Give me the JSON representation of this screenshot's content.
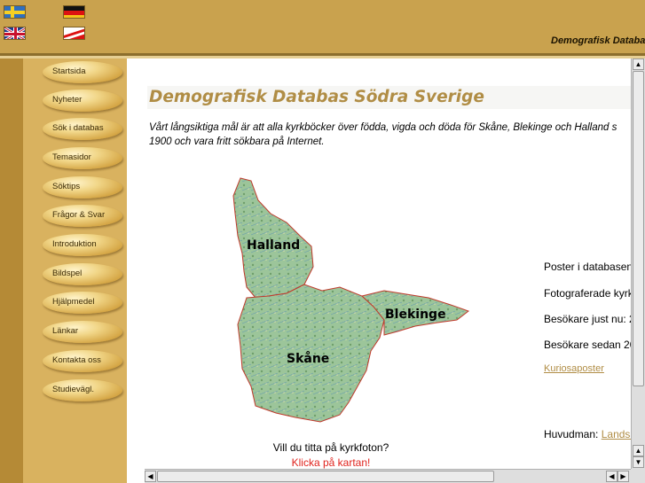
{
  "header": {
    "title": "Demografisk Databas",
    "flags": [
      "flag-sweden",
      "flag-germany",
      "flag-united-kingdom",
      "flag-poland"
    ]
  },
  "sidebar": {
    "items": [
      {
        "label": "Startsida"
      },
      {
        "label": "Nyheter"
      },
      {
        "label": "Sök i databas"
      },
      {
        "label": "Temasidor"
      },
      {
        "label": "Söktips"
      },
      {
        "label": "Frågor & Svar"
      },
      {
        "label": "Introduktion"
      },
      {
        "label": "Bildspel"
      },
      {
        "label": "Hjälpmedel"
      },
      {
        "label": "Länkar"
      },
      {
        "label": "Kontakta oss"
      },
      {
        "label": "Studievägl."
      }
    ]
  },
  "main": {
    "title": "Demografisk Databas Södra Sverige",
    "intro_line1": "Vårt långsiktiga mål är att alla kyrkböcker över födda, vigda och döda för Skåne, Blekinge och Halland s",
    "intro_line2": "1900 och vara fritt sökbara på Internet.",
    "map": {
      "labels": {
        "halland": "Halland",
        "blekinge": "Blekinge",
        "skane": "Skåne"
      },
      "caption": "Vill du titta på kyrkfoton?",
      "link": "Klicka på kartan!"
    },
    "stats": {
      "records": "Poster i databasen",
      "photographed": "Fotograferade kyrk",
      "visitors_now": "Besökare just nu: 2",
      "visitors_since": "Besökare sedan 20",
      "curiosa_link": "Kuriosaposter",
      "principal_label": "Huvudman:",
      "principal_link": "Landsa"
    }
  },
  "colors": {
    "topbar": "#c9a24e",
    "sidebar": "#d9b25f",
    "title_text": "#b08d45",
    "link_red": "#e0241e"
  }
}
